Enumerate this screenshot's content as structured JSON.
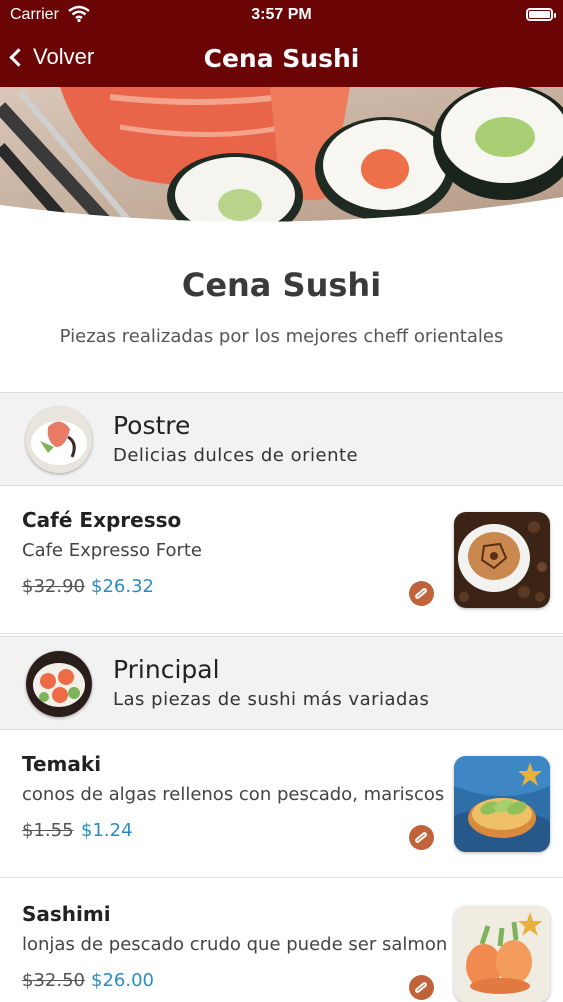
{
  "status_bar": {
    "carrier": "Carrier",
    "time": "3:57 PM"
  },
  "nav": {
    "back_label": "Volver",
    "title": "Cena Sushi"
  },
  "header": {
    "title": "Cena Sushi",
    "subtitle": "Piezas realizadas por los mejores cheff orientales"
  },
  "sections": [
    {
      "title": "Postre",
      "subtitle": "Delicias dulces de oriente",
      "items": [
        {
          "name": "Café Expresso",
          "description": "Cafe Expresso Forte",
          "old_price": "$32.90",
          "price": "$26.32"
        }
      ]
    },
    {
      "title": "Principal",
      "subtitle": "Las piezas de sushi más variadas",
      "items": [
        {
          "name": "Temaki",
          "description": "conos de algas rellenos con pescado, mariscos",
          "old_price": "$1.55",
          "price": "$1.24"
        },
        {
          "name": "Sashimi",
          "description": "lonjas de pescado crudo que puede ser salmon",
          "old_price": "$32.50",
          "price": "$26.00"
        }
      ]
    }
  ],
  "colors": {
    "nav_background": "#6b0404",
    "price_accent": "#2b8cc4",
    "badge": "#c0633b",
    "section_background": "#f2f2f2"
  },
  "icons": {
    "back": "chevron-left-icon",
    "wifi": "wifi-icon",
    "battery": "battery-icon",
    "badge": "peanut-icon"
  }
}
